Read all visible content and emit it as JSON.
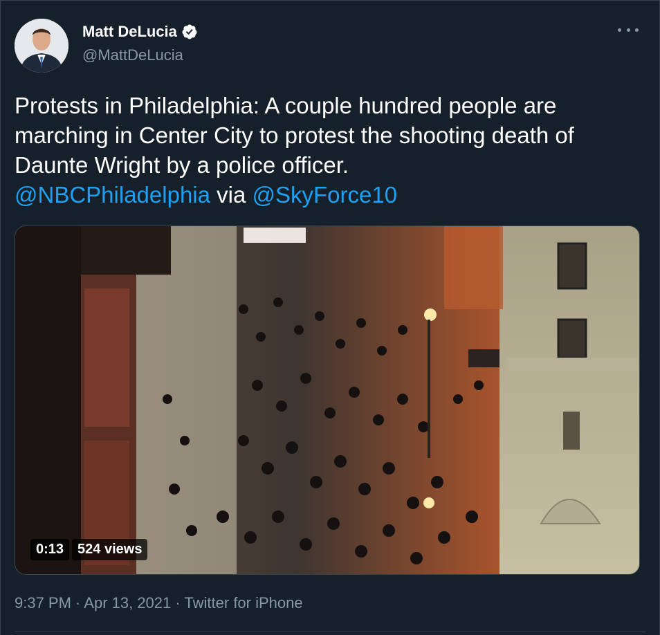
{
  "author": {
    "display_name": "Matt DeLucia",
    "handle": "@MattDeLucia",
    "verified": true,
    "avatar_icon": "profile-photo"
  },
  "tweet": {
    "text_main": "Protests in Philadelphia: A couple hundred people are marching in Center City to protest the shooting death of Daunte Wright by a police officer.",
    "mention_1": "@NBCPhiladelphia",
    "via_word": " via ",
    "mention_2": "@SkyForce10"
  },
  "video": {
    "duration": "0:13",
    "views": "524 views"
  },
  "meta": {
    "time": "9:37 PM",
    "sep_1": " · ",
    "date": "Apr 13, 2021",
    "sep_2": " · ",
    "source": "Twitter for iPhone"
  },
  "colors": {
    "background": "#15202b",
    "link": "#1da1f2",
    "secondary": "#8899a6",
    "verified": "#ffffff"
  },
  "icons": {
    "more": "more-horizontal-icon",
    "verified": "verified-badge-icon"
  }
}
